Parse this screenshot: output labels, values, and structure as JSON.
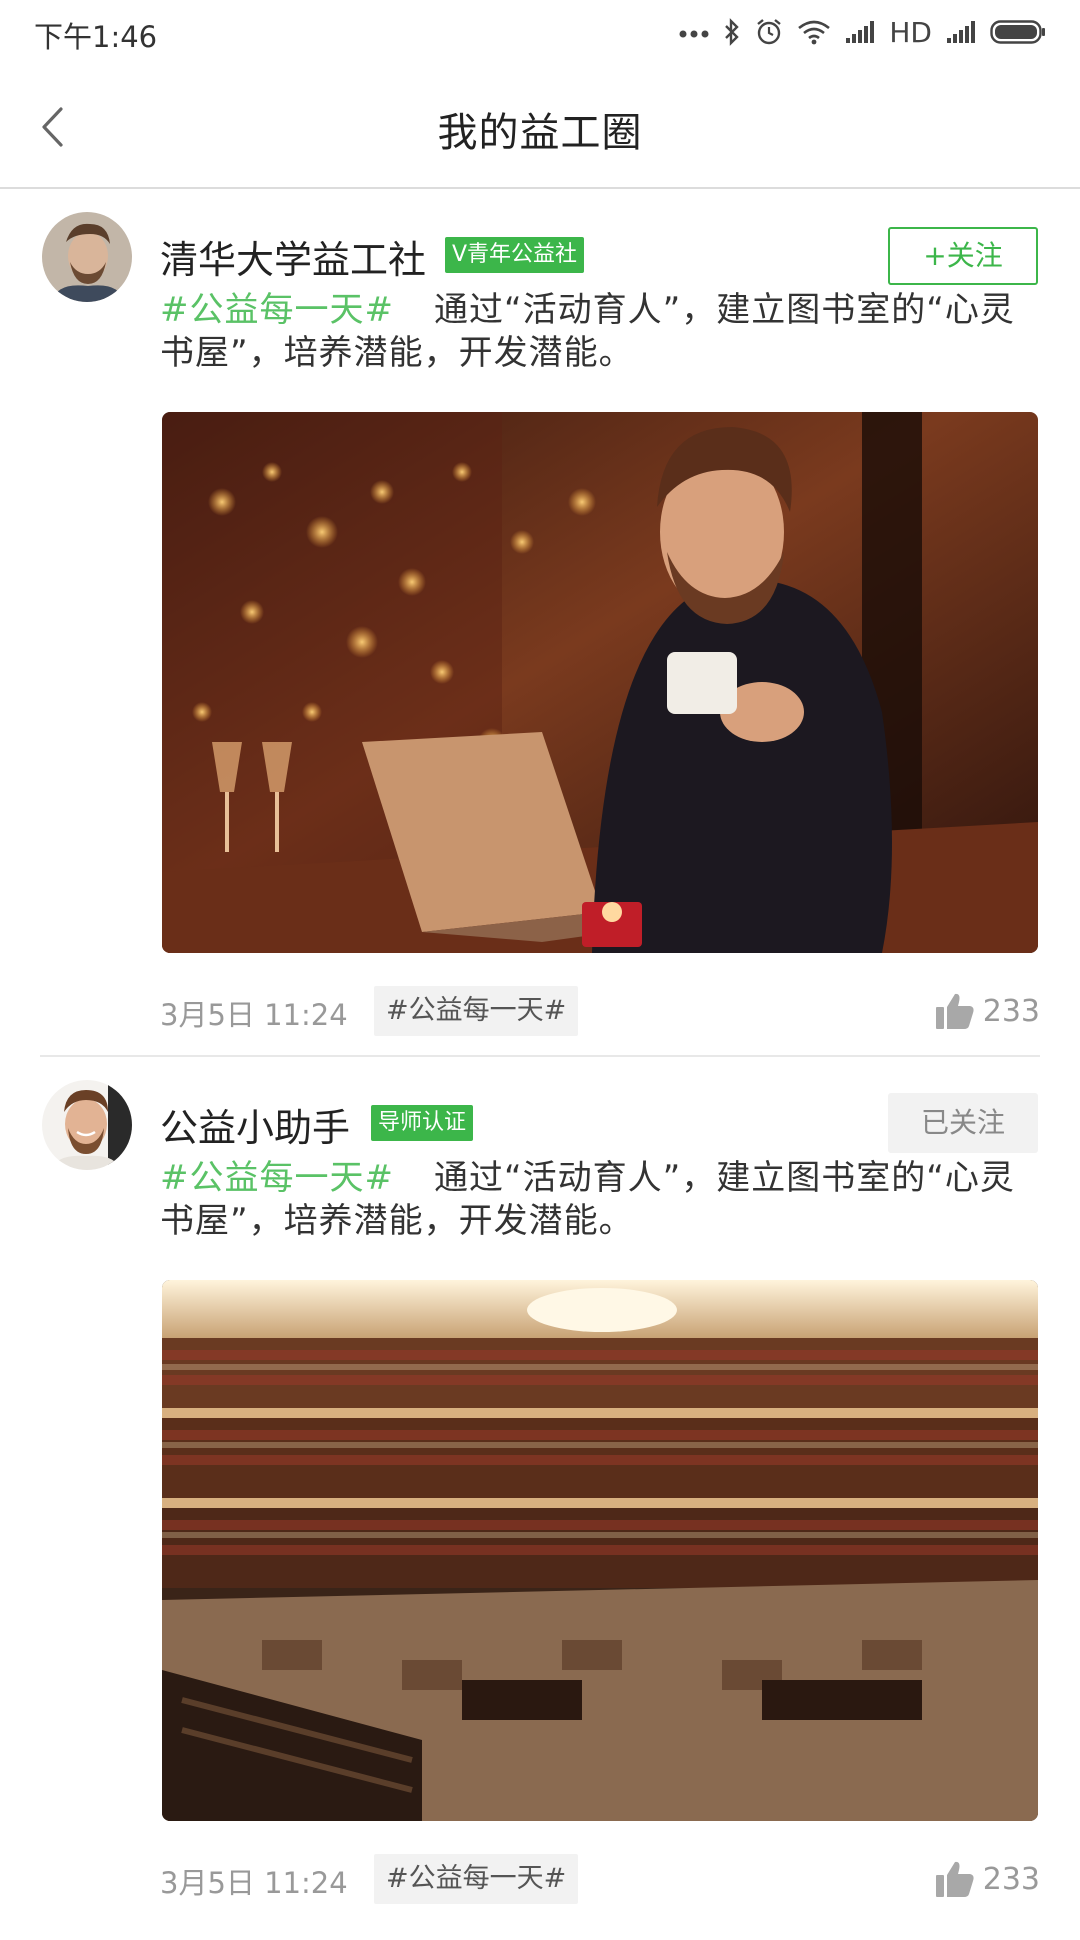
{
  "status_bar": {
    "time": "下午1:46",
    "network": "HD"
  },
  "nav": {
    "title": "我的益工圈",
    "back_icon": "chevron-left-icon"
  },
  "posts": [
    {
      "user_name": "清华大学益工社",
      "badge": "V青年公益社",
      "follow_label": "+关注",
      "followed": false,
      "topic": "#公益每一天#",
      "text": "通过“活动育人”，建立图书室的“心灵书屋”，培养潜能，开发潜能。",
      "time": "3月5日 11:24",
      "tag": "#公益每一天#",
      "likes": "233",
      "image": "man-with-laptop-and-cup-in-cafe"
    },
    {
      "user_name": "公益小助手",
      "badge": "导师认证",
      "follow_label": "已关注",
      "followed": true,
      "topic": "#公益每一天#",
      "text": "通过“活动育人”，建立图书室的“心灵书屋”，培养潜能，开发潜能。",
      "time": "3月5日 11:24",
      "tag": "#公益每一天#",
      "likes": "233",
      "image": "circular-library-interior"
    }
  ],
  "colors": {
    "accent": "#3cb64a",
    "topic": "#5ac266",
    "muted": "#999999"
  }
}
